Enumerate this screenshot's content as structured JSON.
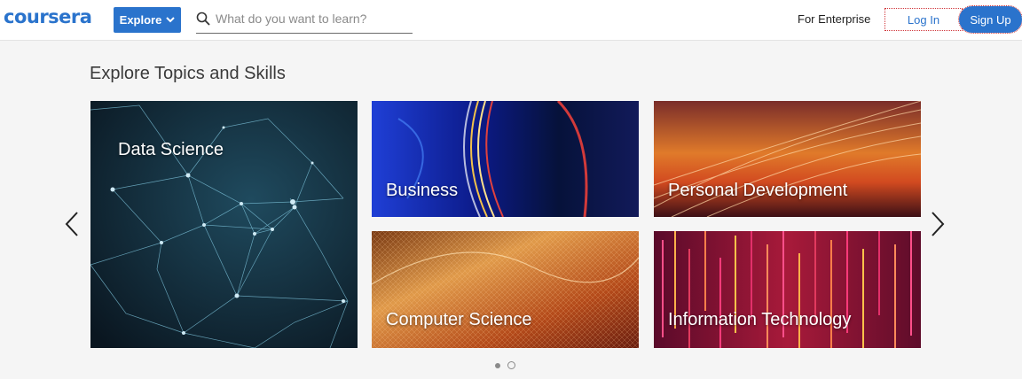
{
  "header": {
    "logo_text": "coursera",
    "explore_label": "Explore",
    "search": {
      "placeholder": "What do you want to learn?",
      "value": ""
    },
    "enterprise_label": "For Enterprise",
    "login_label": "Log In",
    "signup_label": "Sign Up"
  },
  "section": {
    "title": "Explore Topics and Skills",
    "topics": [
      {
        "label": "Data Science"
      },
      {
        "label": "Business"
      },
      {
        "label": "Personal Development"
      },
      {
        "label": "Computer Science"
      },
      {
        "label": "Information Technology"
      }
    ]
  },
  "carousel": {
    "page_count": 2,
    "active_page": 1
  },
  "icons": {
    "explore": "chevron-down-icon",
    "search": "search-icon",
    "prev": "chevron-left-icon",
    "next": "chevron-right-icon"
  },
  "colors": {
    "brand": "#2a73cc",
    "background": "#f5f5f5"
  }
}
